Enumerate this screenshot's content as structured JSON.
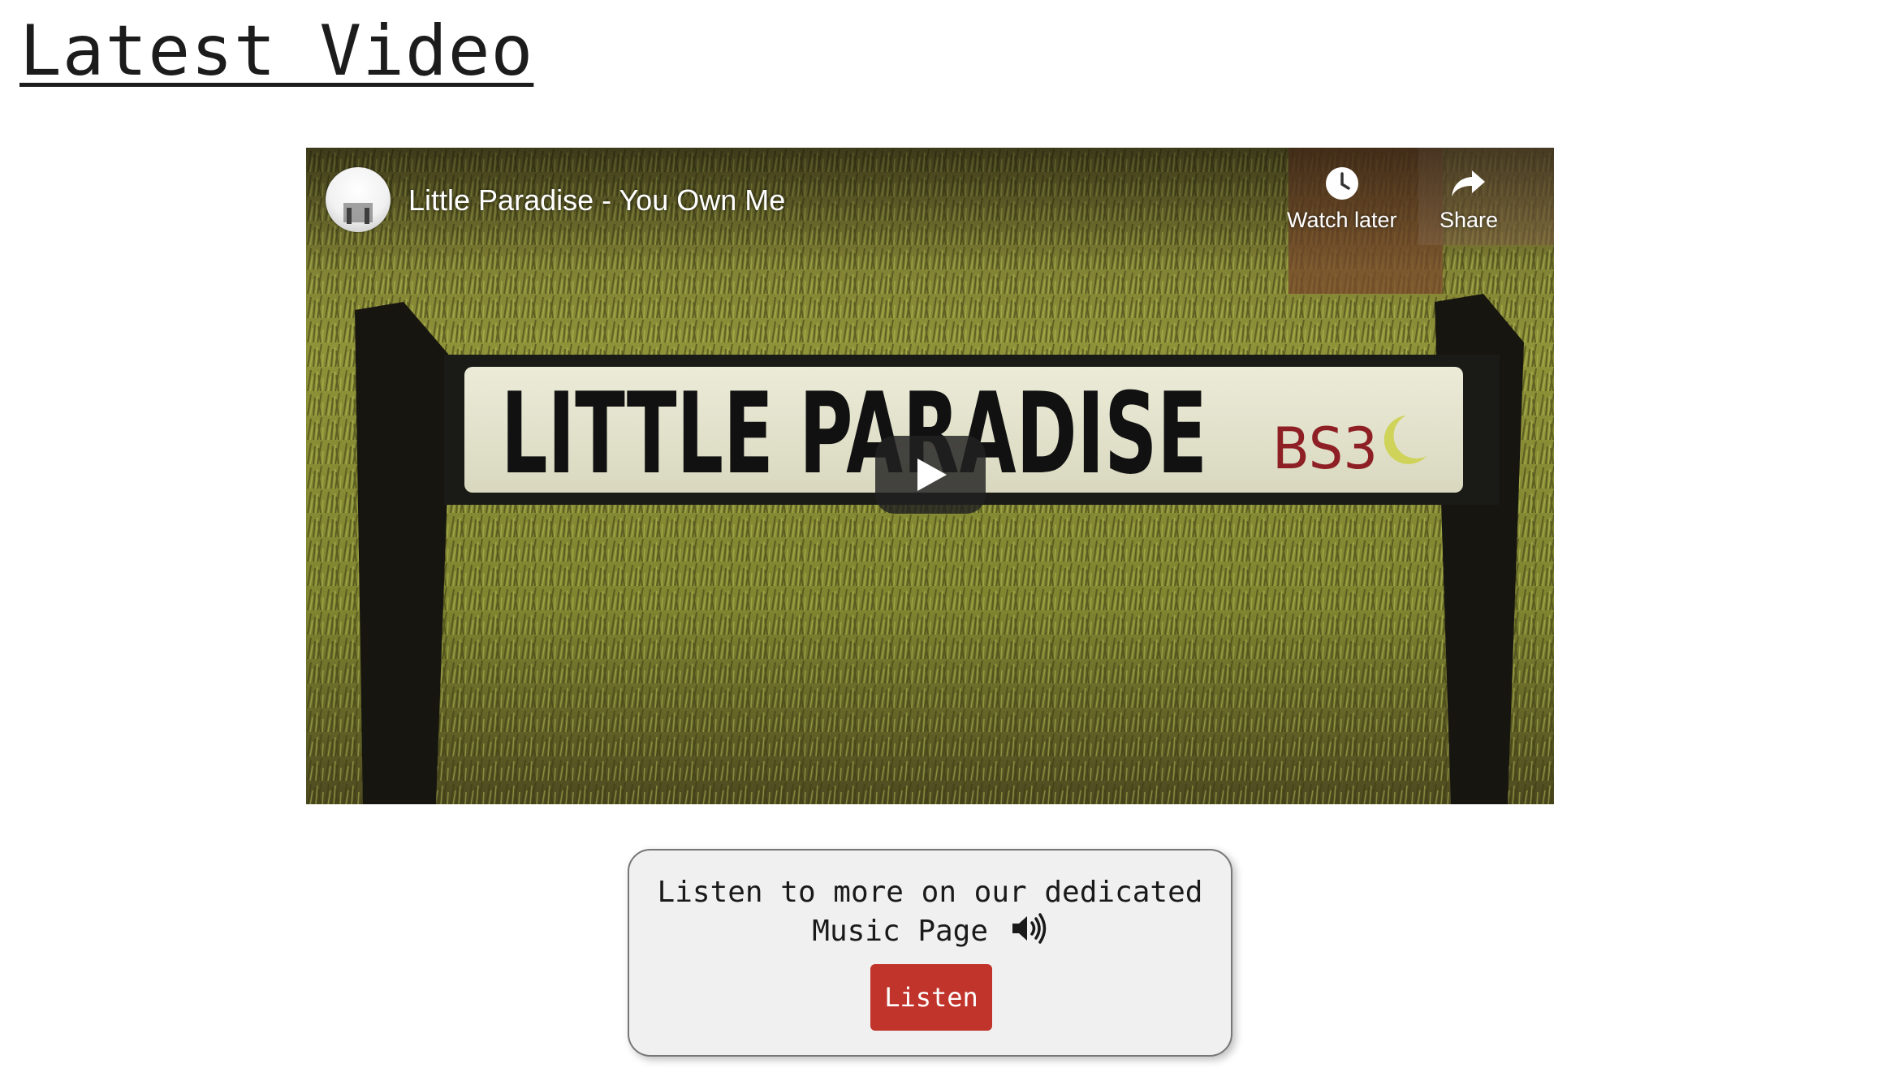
{
  "page": {
    "heading": "Latest Video"
  },
  "video": {
    "title": "Little Paradise - You Own Me",
    "sign_text": "LITTLE PARADISE",
    "sign_postcode": "BS3",
    "watch_later_label": "Watch later",
    "share_label": "Share",
    "play_icon": "play-icon",
    "watch_later_icon": "clock-icon",
    "share_icon": "share-arrow-icon"
  },
  "music_card": {
    "line1": "Listen to more on our dedicated",
    "line2": "Music Page",
    "speaker_icon": "speaker-volume-icon",
    "button_label": "Listen",
    "button_color": "#c0342b"
  }
}
